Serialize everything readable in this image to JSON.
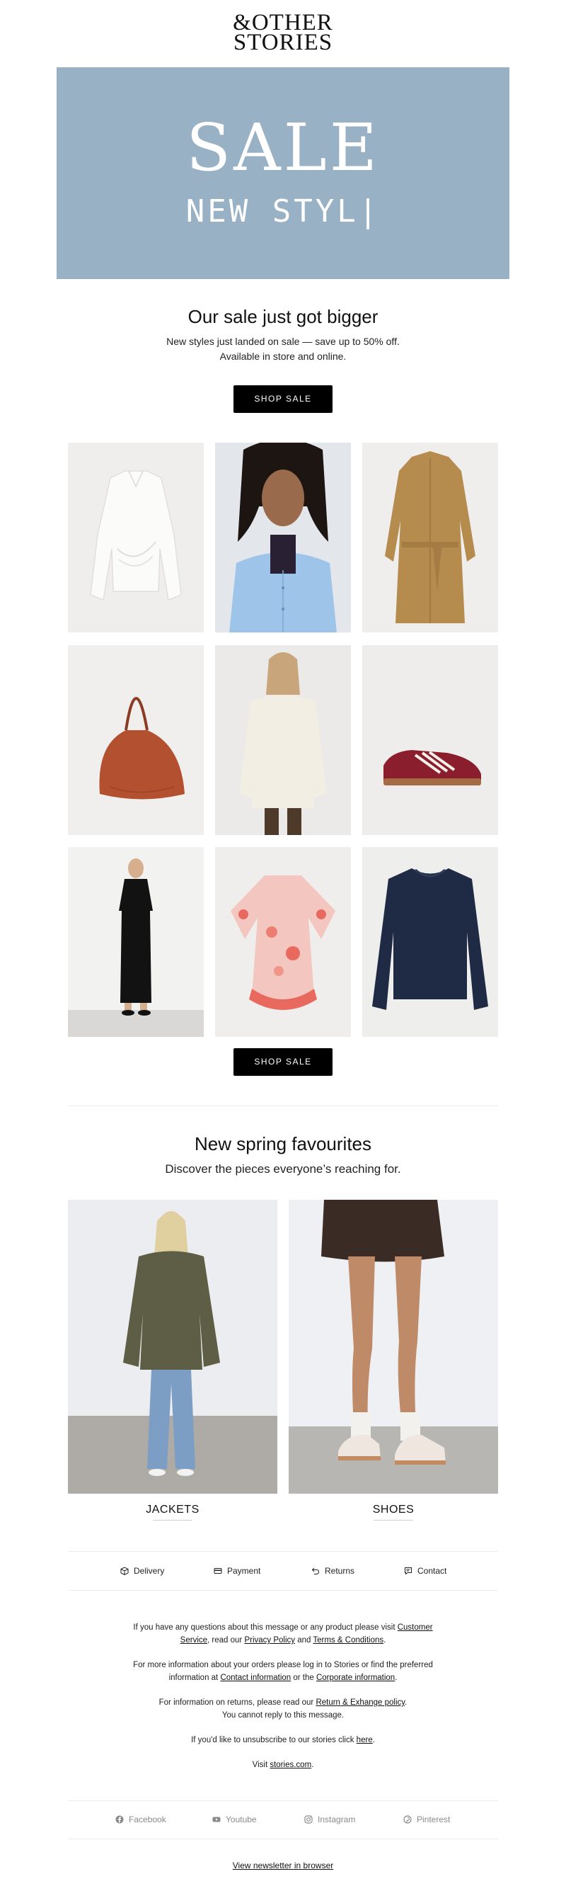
{
  "brand": {
    "logo_line1": "&OTHER",
    "logo_line2": "STORIES"
  },
  "hero": {
    "title": "SALE",
    "subtitle": "NEW STYL|",
    "background": "#99b1c5"
  },
  "sale_section": {
    "title": "Our sale just got bigger",
    "line1": "New styles just landed on sale — save up to 50% off.",
    "line2": "Available in store and online.",
    "button_top": "SHOP SALE",
    "button_bottom": "SHOP SALE"
  },
  "products": [
    {
      "icon": "white-shirt-image"
    },
    {
      "icon": "model-blue-shirt-image"
    },
    {
      "icon": "trench-coat-image"
    },
    {
      "icon": "leather-bag-image"
    },
    {
      "icon": "model-cream-sweater-image"
    },
    {
      "icon": "burgundy-sneaker-image"
    },
    {
      "icon": "model-black-dress-image"
    },
    {
      "icon": "floral-dress-image"
    },
    {
      "icon": "navy-sweater-image"
    }
  ],
  "spring_section": {
    "title": "New spring favourites",
    "subtitle": "Discover the pieces everyone’s reaching for.",
    "categories": [
      {
        "label": "JACKETS"
      },
      {
        "label": "SHOES"
      }
    ]
  },
  "services": [
    {
      "label": "Delivery",
      "icon": "box-icon"
    },
    {
      "label": "Payment",
      "icon": "card-icon"
    },
    {
      "label": "Returns",
      "icon": "return-arrow-icon"
    },
    {
      "label": "Contact",
      "icon": "chat-icon"
    }
  ],
  "footer": {
    "p1_a": "If you have any questions about this message or any product please visit ",
    "p1_link1a": "Customer",
    "p1_link1b": "Service",
    "p1_b": ", read our ",
    "p1_link2": "Privacy Policy",
    "p1_c": " and ",
    "p1_link3": "Terms & Conditions",
    "p1_d": ".",
    "p2_a": "For more information about your orders please log in to Stories or find the preferred",
    "p2_b": "information at ",
    "p2_link1": "Contact information",
    "p2_c": " or the ",
    "p2_link2": "Corporate information",
    "p2_d": ".",
    "p3_a": "For information on returns, please read our ",
    "p3_link": "Return & Exhange policy",
    "p3_b": ".",
    "p3_line2": "You cannot reply to this message.",
    "p4_a": "If you'd like to unsubscribe to our stories click ",
    "p4_link": "here",
    "p4_b": ".",
    "p5_a": "Visit ",
    "p5_link": "stories.com",
    "p5_b": "."
  },
  "social": [
    {
      "label": "Facebook",
      "icon": "facebook-icon"
    },
    {
      "label": "Youtube",
      "icon": "youtube-icon"
    },
    {
      "label": "Instagram",
      "icon": "instagram-icon"
    },
    {
      "label": "Pinterest",
      "icon": "pinterest-icon"
    }
  ],
  "view_in_browser": "View newsletter in browser"
}
